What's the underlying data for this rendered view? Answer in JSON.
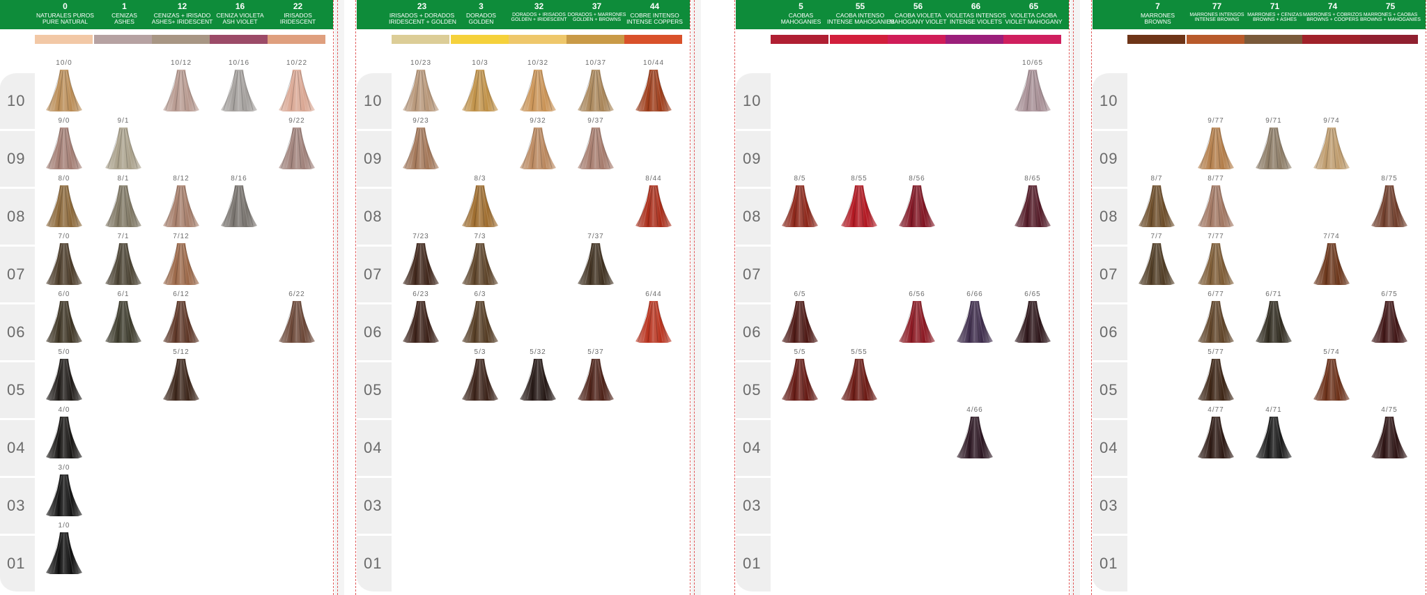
{
  "row_levels": [
    "10",
    "09",
    "08",
    "07",
    "06",
    "05",
    "04",
    "03",
    "01"
  ],
  "panels": [
    {
      "columns": [
        {
          "num": "0",
          "es": "NATURALES PUROS",
          "en": "PURE NATURAL",
          "color": "#f2c8a6"
        },
        {
          "num": "1",
          "es": "CENIZAS",
          "en": "ASHES",
          "color": "#b6a2a2"
        },
        {
          "num": "12",
          "es": "CENIZAS + IRISADO",
          "en": "ASHES+ IRIDESCENT",
          "color": "#a89684"
        },
        {
          "num": "16",
          "es": "CENIZA VIOLETA",
          "en": "ASH VIOLET",
          "color": "#9c4b68"
        },
        {
          "num": "22",
          "es": "IRISADOS",
          "en": "IRIDESCENT",
          "color": "#df9f7e"
        }
      ],
      "swatches": [
        {
          "code": "10/0",
          "col": 0,
          "row": 0,
          "color": "#b98b54"
        },
        {
          "code": "10/12",
          "col": 2,
          "row": 0,
          "color": "#b6988e"
        },
        {
          "code": "10/16",
          "col": 3,
          "row": 0,
          "color": "#a29e9b"
        },
        {
          "code": "10/22",
          "col": 4,
          "row": 0,
          "color": "#d9a692"
        },
        {
          "code": "9/0",
          "col": 0,
          "row": 1,
          "color": "#a27c72"
        },
        {
          "code": "9/1",
          "col": 1,
          "row": 1,
          "color": "#a89f89"
        },
        {
          "code": "9/22",
          "col": 4,
          "row": 1,
          "color": "#9f8079"
        },
        {
          "code": "8/0",
          "col": 0,
          "row": 2,
          "color": "#8a6637"
        },
        {
          "code": "8/1",
          "col": 1,
          "row": 2,
          "color": "#7d7561"
        },
        {
          "code": "8/12",
          "col": 2,
          "row": 2,
          "color": "#a47b67"
        },
        {
          "code": "8/16",
          "col": 3,
          "row": 2,
          "color": "#76716c"
        },
        {
          "code": "7/0",
          "col": 0,
          "row": 3,
          "color": "#4a3a27"
        },
        {
          "code": "7/1",
          "col": 1,
          "row": 3,
          "color": "#4a4232"
        },
        {
          "code": "7/12",
          "col": 2,
          "row": 3,
          "color": "#9a6646"
        },
        {
          "code": "6/0",
          "col": 0,
          "row": 4,
          "color": "#3c3322"
        },
        {
          "code": "6/1",
          "col": 1,
          "row": 4,
          "color": "#3c3a2b"
        },
        {
          "code": "6/12",
          "col": 2,
          "row": 4,
          "color": "#5c3424"
        },
        {
          "code": "6/22",
          "col": 4,
          "row": 4,
          "color": "#6a4535"
        },
        {
          "code": "5/0",
          "col": 0,
          "row": 5,
          "color": "#1e1a17"
        },
        {
          "code": "5/12",
          "col": 2,
          "row": 5,
          "color": "#3b2418"
        },
        {
          "code": "4/0",
          "col": 0,
          "row": 6,
          "color": "#161412"
        },
        {
          "code": "3/0",
          "col": 0,
          "row": 7,
          "color": "#121212"
        },
        {
          "code": "1/0",
          "col": 0,
          "row": 8,
          "color": "#0e0e0e"
        }
      ]
    },
    {
      "columns": [
        {
          "num": "23",
          "es": "IRISADOS + DORADOS",
          "en": "IRIDESCENT + GOLDEN",
          "color": "#dccd97"
        },
        {
          "num": "3",
          "es": "DORADOS",
          "en": "GOLDEN",
          "color": "#f5d13b"
        },
        {
          "num": "32",
          "es": "DORADOS + IRISADOS",
          "en": "GOLDEN + IRIDESCENT",
          "color": "#eec76b",
          "small": true
        },
        {
          "num": "37",
          "es": "DORADOS + MARRONES",
          "en": "GOLDEN + BROWNS",
          "color": "#c99a47",
          "small": true
        },
        {
          "num": "44",
          "es": "COBRE INTENSO",
          "en": "INTENSE COPPERS",
          "color": "#d9512a"
        }
      ],
      "swatches": [
        {
          "code": "10/23",
          "col": 0,
          "row": 0,
          "color": "#b69577"
        },
        {
          "code": "10/3",
          "col": 1,
          "row": 0,
          "color": "#bf9046"
        },
        {
          "code": "10/32",
          "col": 2,
          "row": 0,
          "color": "#c99254"
        },
        {
          "code": "10/37",
          "col": 3,
          "row": 0,
          "color": "#a88457"
        },
        {
          "code": "10/44",
          "col": 4,
          "row": 0,
          "color": "#9c3a17"
        },
        {
          "code": "9/23",
          "col": 0,
          "row": 1,
          "color": "#a27556"
        },
        {
          "code": "9/32",
          "col": 2,
          "row": 1,
          "color": "#b9865c"
        },
        {
          "code": "9/37",
          "col": 3,
          "row": 1,
          "color": "#a57a6b"
        },
        {
          "code": "8/3",
          "col": 1,
          "row": 2,
          "color": "#9d6b2c"
        },
        {
          "code": "8/44",
          "col": 4,
          "row": 2,
          "color": "#a82a16"
        },
        {
          "code": "7/23",
          "col": 0,
          "row": 3,
          "color": "#3e2418"
        },
        {
          "code": "7/3",
          "col": 1,
          "row": 3,
          "color": "#5b4126"
        },
        {
          "code": "7/37",
          "col": 3,
          "row": 3,
          "color": "#3e2f1e"
        },
        {
          "code": "6/23",
          "col": 0,
          "row": 4,
          "color": "#3a1f16"
        },
        {
          "code": "6/3",
          "col": 1,
          "row": 4,
          "color": "#533a21"
        },
        {
          "code": "6/44",
          "col": 4,
          "row": 4,
          "color": "#b7301b"
        },
        {
          "code": "5/3",
          "col": 1,
          "row": 5,
          "color": "#3a2117"
        },
        {
          "code": "5/32",
          "col": 2,
          "row": 5,
          "color": "#241714"
        },
        {
          "code": "5/37",
          "col": 3,
          "row": 5,
          "color": "#4c2016"
        }
      ]
    },
    {
      "columns": [
        {
          "num": "5",
          "es": "CAOBAS",
          "en": "MAHOGANIES",
          "color": "#b01f33"
        },
        {
          "num": "55",
          "es": "CAOBA INTENSO",
          "en": "INTENSE MAHOGANIES",
          "color": "#d21f3c"
        },
        {
          "num": "56",
          "es": "CAOBA VIOLETA",
          "en": "MAHOGANY VIOLET",
          "color": "#d01d58"
        },
        {
          "num": "66",
          "es": "VIOLETAS INTENSOS",
          "en": "INTENSE VIOLETS",
          "color": "#9b1f7a"
        },
        {
          "num": "65",
          "es": "VIOLETA CAOBA",
          "en": "VIOLET MAHOGANY",
          "color": "#cf1f5e"
        }
      ],
      "swatches": [
        {
          "code": "10/65",
          "col": 4,
          "row": 0,
          "color": "#a58d93"
        },
        {
          "code": "8/5",
          "col": 0,
          "row": 2,
          "color": "#8b2417"
        },
        {
          "code": "8/55",
          "col": 1,
          "row": 2,
          "color": "#b0141e"
        },
        {
          "code": "8/56",
          "col": 2,
          "row": 2,
          "color": "#7f1220"
        },
        {
          "code": "8/65",
          "col": 4,
          "row": 2,
          "color": "#521825"
        },
        {
          "code": "6/5",
          "col": 0,
          "row": 4,
          "color": "#4c1612"
        },
        {
          "code": "6/56",
          "col": 2,
          "row": 4,
          "color": "#8a1620"
        },
        {
          "code": "6/66",
          "col": 3,
          "row": 4,
          "color": "#3c2a4a"
        },
        {
          "code": "6/65",
          "col": 4,
          "row": 4,
          "color": "#2c1418"
        },
        {
          "code": "5/5",
          "col": 0,
          "row": 5,
          "color": "#641812"
        },
        {
          "code": "5/55",
          "col": 1,
          "row": 5,
          "color": "#6a1812"
        },
        {
          "code": "4/66",
          "col": 3,
          "row": 6,
          "color": "#2a1420"
        }
      ]
    },
    {
      "columns": [
        {
          "num": "7",
          "es": "MARRONES",
          "en": "BROWNS",
          "color": "#6e3518"
        },
        {
          "num": "77",
          "es": "MARRONES INTENSOS",
          "en": "INTENSE BROWNS",
          "color": "#b85a2b",
          "small": true
        },
        {
          "num": "71",
          "es": "MARRONES + CENIZAS",
          "en": "BROWNS + ASHES",
          "color": "#7a5a3b",
          "small": true
        },
        {
          "num": "74",
          "es": "MARRONES + COBRIZOS",
          "en": "BROWNS + COOPERS",
          "color": "#a0222a",
          "small": true
        },
        {
          "num": "75",
          "es": "MARRONES + CAOBAS",
          "en": "BROWNS + MAHOGANIES",
          "color": "#902030",
          "small": true
        }
      ],
      "swatches": [
        {
          "code": "9/77",
          "col": 1,
          "row": 1,
          "color": "#b27c48"
        },
        {
          "code": "9/71",
          "col": 2,
          "row": 1,
          "color": "#8b7a64"
        },
        {
          "code": "9/74",
          "col": 3,
          "row": 1,
          "color": "#bd9a6b"
        },
        {
          "code": "8/7",
          "col": 0,
          "row": 2,
          "color": "#6b4b27"
        },
        {
          "code": "8/77",
          "col": 1,
          "row": 2,
          "color": "#a07560"
        },
        {
          "code": "8/75",
          "col": 4,
          "row": 2,
          "color": "#6e3b28"
        },
        {
          "code": "7/7",
          "col": 0,
          "row": 3,
          "color": "#4e3a22"
        },
        {
          "code": "7/77",
          "col": 1,
          "row": 3,
          "color": "#7c5a33"
        },
        {
          "code": "7/74",
          "col": 3,
          "row": 3,
          "color": "#6a3418"
        },
        {
          "code": "6/77",
          "col": 1,
          "row": 4,
          "color": "#5e4226"
        },
        {
          "code": "6/71",
          "col": 2,
          "row": 4,
          "color": "#2f2a1e"
        },
        {
          "code": "6/75",
          "col": 4,
          "row": 4,
          "color": "#3f1414"
        },
        {
          "code": "5/77",
          "col": 1,
          "row": 5,
          "color": "#3c2414"
        },
        {
          "code": "5/74",
          "col": 3,
          "row": 5,
          "color": "#6a2e16"
        },
        {
          "code": "4/77",
          "col": 1,
          "row": 6,
          "color": "#2c1812"
        },
        {
          "code": "4/71",
          "col": 2,
          "row": 6,
          "color": "#181818"
        },
        {
          "code": "4/75",
          "col": 4,
          "row": 6,
          "color": "#2c1212"
        }
      ]
    }
  ]
}
